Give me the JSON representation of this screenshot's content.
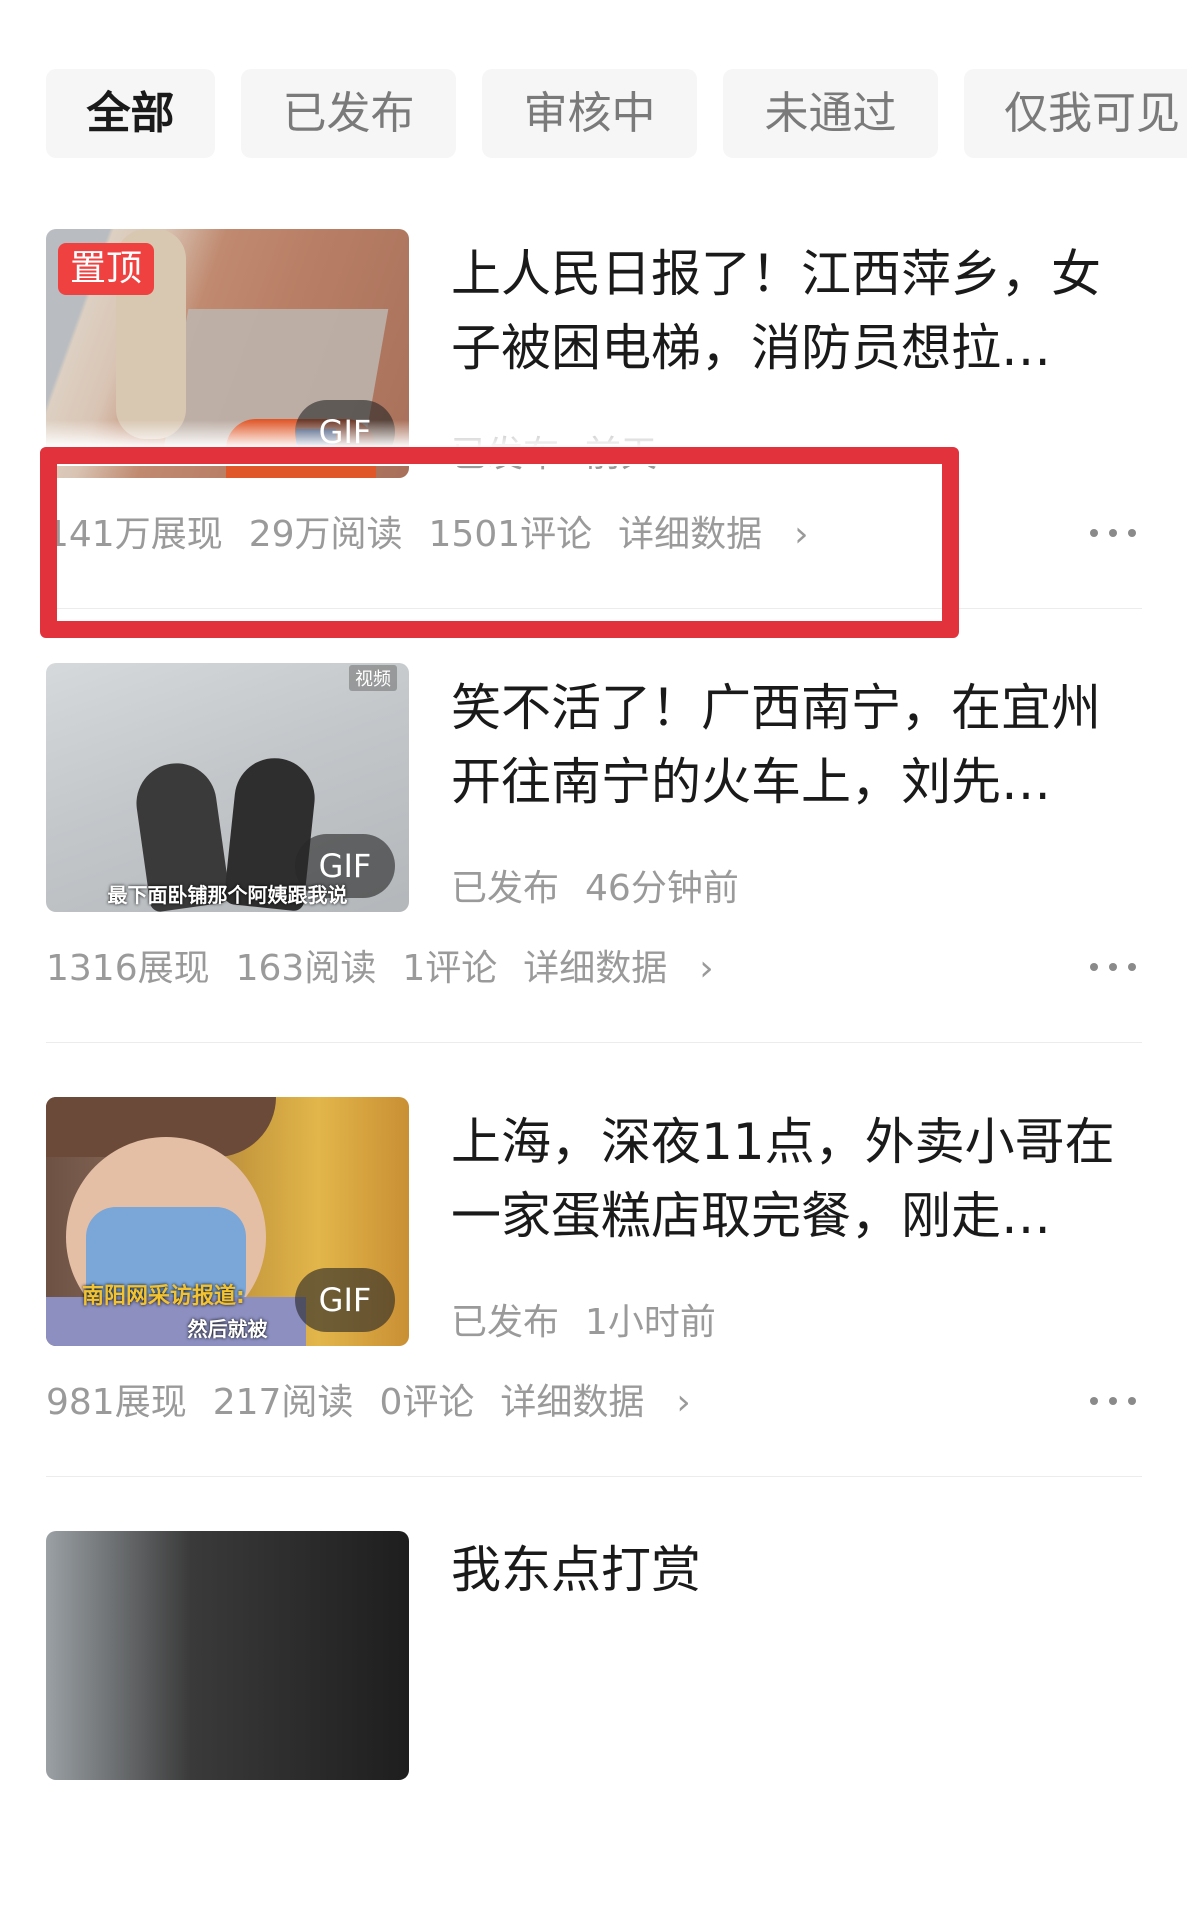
{
  "tabs": [
    {
      "label": "全部"
    },
    {
      "label": "已发布"
    },
    {
      "label": "审核中"
    },
    {
      "label": "未通过"
    },
    {
      "label": "仅我可见"
    }
  ],
  "articles": [
    {
      "pin_label": "置顶",
      "gif_label": "GIF",
      "title": "上人民日报了！江西萍乡，女子被困电梯，消防员想拉…",
      "status": "已发布",
      "time": "前天",
      "impressions": "141万展现",
      "reads": "29万阅读",
      "comments": "1501评论",
      "detail_link": "详细数据",
      "thumb_colors": [
        "#c9a894",
        "#a58778"
      ]
    },
    {
      "gif_label": "GIF",
      "corner_tag": "视频",
      "caption": "最下面卧铺那个阿姨跟我说",
      "title": "笑不活了！广西南宁，在宜州开往南宁的火车上，刘先…",
      "status": "已发布",
      "time": "46分钟前",
      "impressions": "1316展现",
      "reads": "163阅读",
      "comments": "1评论",
      "detail_link": "详细数据",
      "thumb_colors": [
        "#c4c7c9",
        "#9ea3a6"
      ]
    },
    {
      "gif_label": "GIF",
      "caption_yellow": "南阳网采访报道:",
      "caption": "然后就被",
      "title": "上海，深夜11点，外卖小哥在一家蛋糕店取完餐，刚走…",
      "status": "已发布",
      "time": "1小时前",
      "impressions": "981展现",
      "reads": "217阅读",
      "comments": "0评论",
      "detail_link": "详细数据",
      "thumb_colors": [
        "#d9a950",
        "#6f86b7"
      ]
    },
    {
      "title": "我东点打赏"
    }
  ],
  "colors": {
    "highlight": "#e2323c",
    "pin_badge": "#f04141",
    "muted_text": "#9a9a9a"
  }
}
